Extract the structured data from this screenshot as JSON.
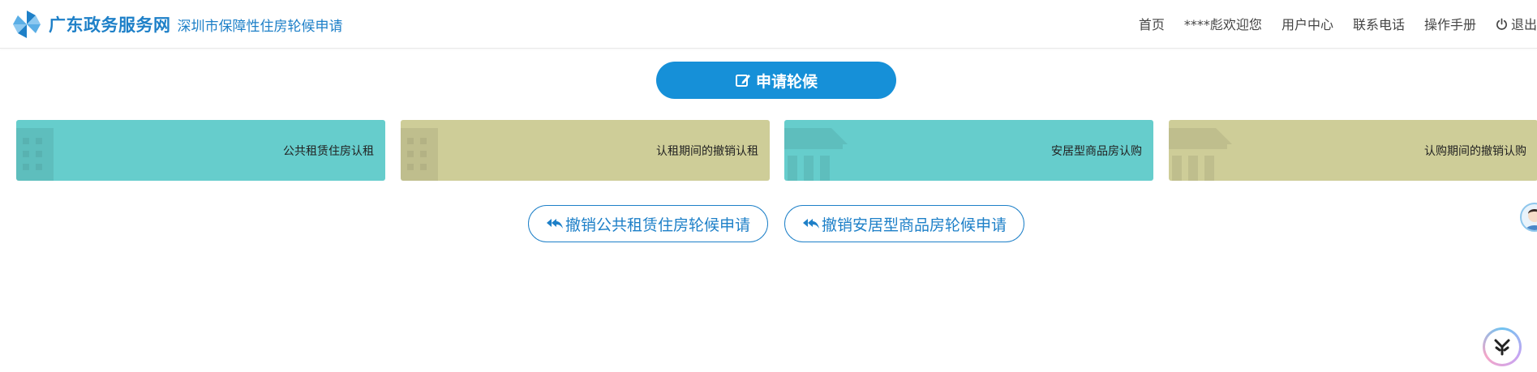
{
  "header": {
    "site_name": "广东政务服务网",
    "subtitle": "深圳市保障性住房轮候申请",
    "brand_color": "#1e80c8",
    "nav": [
      {
        "label": "首页"
      },
      {
        "label": "****彪欢迎您"
      },
      {
        "label": "用户中心"
      },
      {
        "label": "联系电话"
      },
      {
        "label": "操作手册"
      },
      {
        "label": "退出",
        "icon": "power-icon"
      }
    ]
  },
  "apply_button": {
    "label": "申请轮候",
    "icon": "edit-icon",
    "color": "#1690d8"
  },
  "cards": [
    {
      "label": "公共租赁住房认租",
      "icon": "building-icon",
      "color": "#66cdcc"
    },
    {
      "label": "认租期间的撤销认租",
      "icon": "building-icon",
      "color": "#cecd98"
    },
    {
      "label": "安居型商品房认购",
      "icon": "bank-icon",
      "color": "#66cdcc"
    },
    {
      "label": "认购期间的撤销认购",
      "icon": "bank-icon",
      "color": "#cecd98"
    }
  ],
  "revoke_buttons": [
    {
      "label": "撤销公共租赁住房轮候申请",
      "icon": "reply-all-icon"
    },
    {
      "label": "撤销安居型商品房轮候申请",
      "icon": "reply-all-icon"
    }
  ]
}
